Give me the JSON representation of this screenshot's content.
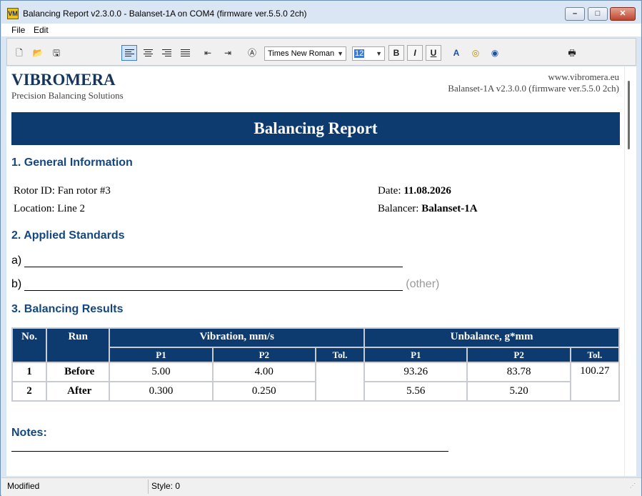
{
  "window": {
    "title": "Balancing Report v2.3.0.0 - Balanset-1A on COM4 (firmware ver.5.5.0 2ch)",
    "icon_text": "VM"
  },
  "menu": {
    "file": "File",
    "edit": "Edit"
  },
  "toolbar": {
    "font": "Times New Roman",
    "size": "12",
    "bold": "B",
    "italic": "I",
    "underline": "U"
  },
  "header": {
    "brand": "VIBROMERA",
    "tagline": "Precision Balancing Solutions",
    "website": "www.vibromera.eu",
    "version": "Balanset-1A v2.3.0.0 (firmware ver.5.5.0 2ch)"
  },
  "report_title": "Balancing Report",
  "general": {
    "heading": "1. General Information",
    "rotor_label": "Rotor ID:",
    "rotor_value": "Fan rotor #3",
    "location_label": "Location:",
    "location_value": "Line 2",
    "date_label": "Date:",
    "date_value": "11.08.2026",
    "balancer_label": "Balancer:",
    "balancer_value": "Balanset-1A"
  },
  "standards": {
    "heading": "2. Applied Standards",
    "a_label": "a)",
    "b_label": "b)",
    "other_hint": "(other)"
  },
  "results": {
    "heading": "3. Balancing Results",
    "col_no": "No.",
    "col_run": "Run",
    "col_vibration": "Vibration, mm/s",
    "col_unbalance": "Unbalance, g*mm",
    "p1": "P1",
    "p2": "P2",
    "tol": "Tol.",
    "unbalance_tol": "100.27",
    "rows": [
      {
        "no": "1",
        "run": "Before",
        "vib_p1": "5.00",
        "vib_p2": "4.00",
        "unb_p1": "93.26",
        "unb_p2": "83.78"
      },
      {
        "no": "2",
        "run": "After",
        "vib_p1": "0.300",
        "vib_p2": "0.250",
        "unb_p1": "5.56",
        "unb_p2": "5.20"
      }
    ]
  },
  "notes": {
    "heading": "Notes:"
  },
  "status": {
    "left": "Modified",
    "right": "Style: 0"
  }
}
